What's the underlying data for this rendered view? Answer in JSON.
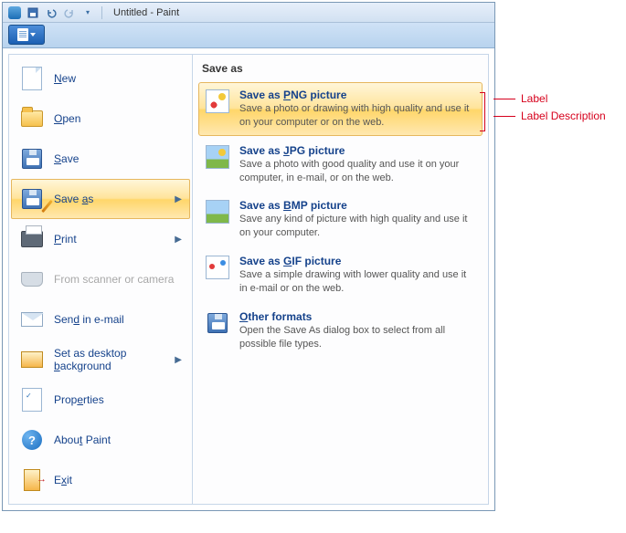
{
  "titlebar": {
    "title": "Untitled - Paint"
  },
  "menu": {
    "items": [
      {
        "label": "New",
        "ukey": "N",
        "rest": "ew"
      },
      {
        "label": "Open",
        "ukey": "O",
        "rest": "pen"
      },
      {
        "label": "Save",
        "ukey": "S",
        "rest": "ave"
      },
      {
        "label": "Save as",
        "pre": "Save ",
        "ukey": "a",
        "rest": "s"
      },
      {
        "label": "Print",
        "ukey": "P",
        "rest": "rint"
      },
      {
        "label": "From scanner or camera"
      },
      {
        "label": "Send in e-mail",
        "pre": "Sen",
        "ukey": "d",
        "rest": " in e-mail"
      },
      {
        "label": "Set as desktop background",
        "pre": "Set as desktop ",
        "ukey": "b",
        "rest": "ackground"
      },
      {
        "label": "Properties",
        "pre": "Prop",
        "ukey": "e",
        "rest": "rties"
      },
      {
        "label": "About Paint",
        "pre": "Abou",
        "ukey": "t",
        "rest": " Paint"
      },
      {
        "label": "Exit",
        "pre": "E",
        "ukey": "x",
        "rest": "it"
      }
    ]
  },
  "panel": {
    "heading": "Save as",
    "formats": [
      {
        "title_pre": "Save as ",
        "title_u": "P",
        "title_post": "NG picture",
        "desc": "Save a photo or drawing with high quality and use it on your computer or on the web."
      },
      {
        "title_pre": "Save as ",
        "title_u": "J",
        "title_post": "PG picture",
        "desc": "Save a photo with good quality and use it on your computer, in e-mail, or on the web."
      },
      {
        "title_pre": "Save as ",
        "title_u": "B",
        "title_post": "MP picture",
        "desc": "Save any kind of picture with high quality and use it on your computer."
      },
      {
        "title_pre": "Save as ",
        "title_u": "G",
        "title_post": "IF picture",
        "desc": "Save a simple drawing with lower quality and use it in e-mail or on the web."
      },
      {
        "title_pre": "",
        "title_u": "O",
        "title_post": "ther formats",
        "desc": "Open the Save As dialog box to select from all possible file types."
      }
    ]
  },
  "annotations": {
    "label": "Label",
    "desc": "Label Description"
  }
}
